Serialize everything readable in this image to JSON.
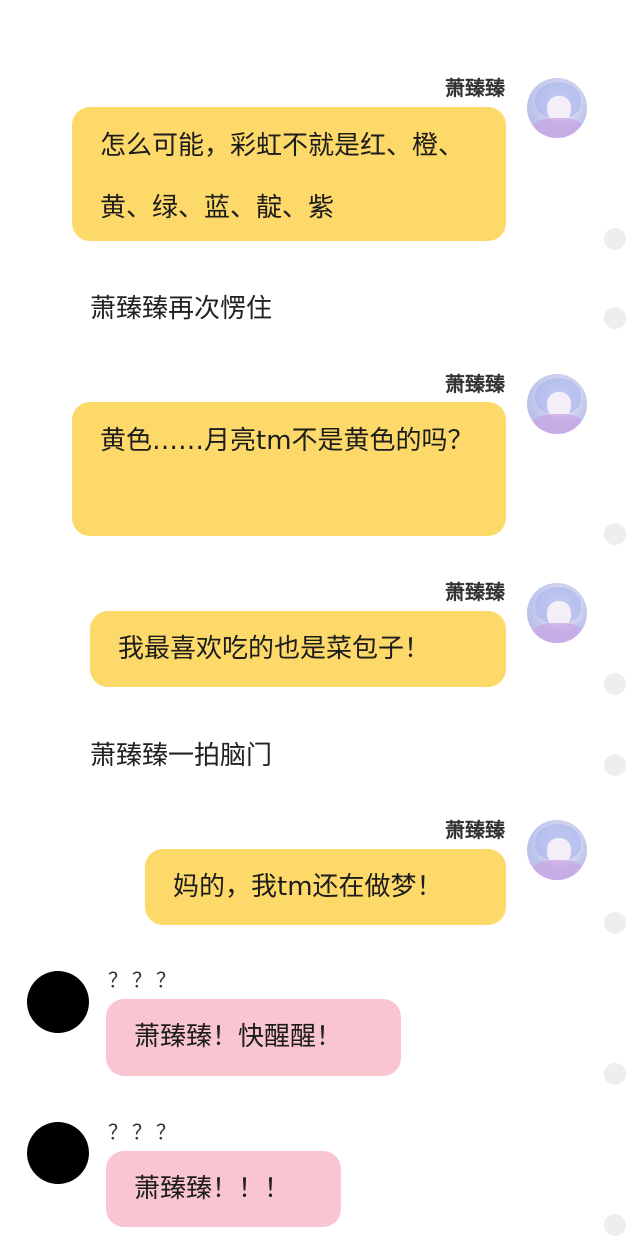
{
  "messages": [
    {
      "sender": "萧臻臻",
      "text": "怎么可能，彩虹不就是红、橙、黄、绿、蓝、靛、紫"
    },
    {
      "narration": "萧臻臻再次愣住"
    },
    {
      "sender": "萧臻臻",
      "text": "黄色……月亮tm不是黄色的吗？"
    },
    {
      "sender": "萧臻臻",
      "text": "我最喜欢吃的也是菜包子！"
    },
    {
      "narration": "萧臻臻一拍脑门"
    },
    {
      "sender": "萧臻臻",
      "text": "妈的，我tm还在做梦！"
    },
    {
      "sender": "？？？",
      "text": "萧臻臻！快醒醒！"
    },
    {
      "sender": "？？？",
      "text": "萧臻臻！！！"
    }
  ],
  "colors": {
    "self_bubble": "#fdd969",
    "other_bubble": "#f9c5d0",
    "other_avatar": "#000000",
    "side_dot": "#eeeeee"
  },
  "icons": {
    "self_avatar": "anime-girl-avatar",
    "other_avatar": "black-circle-avatar",
    "side_dot": "select-dot-icon"
  }
}
